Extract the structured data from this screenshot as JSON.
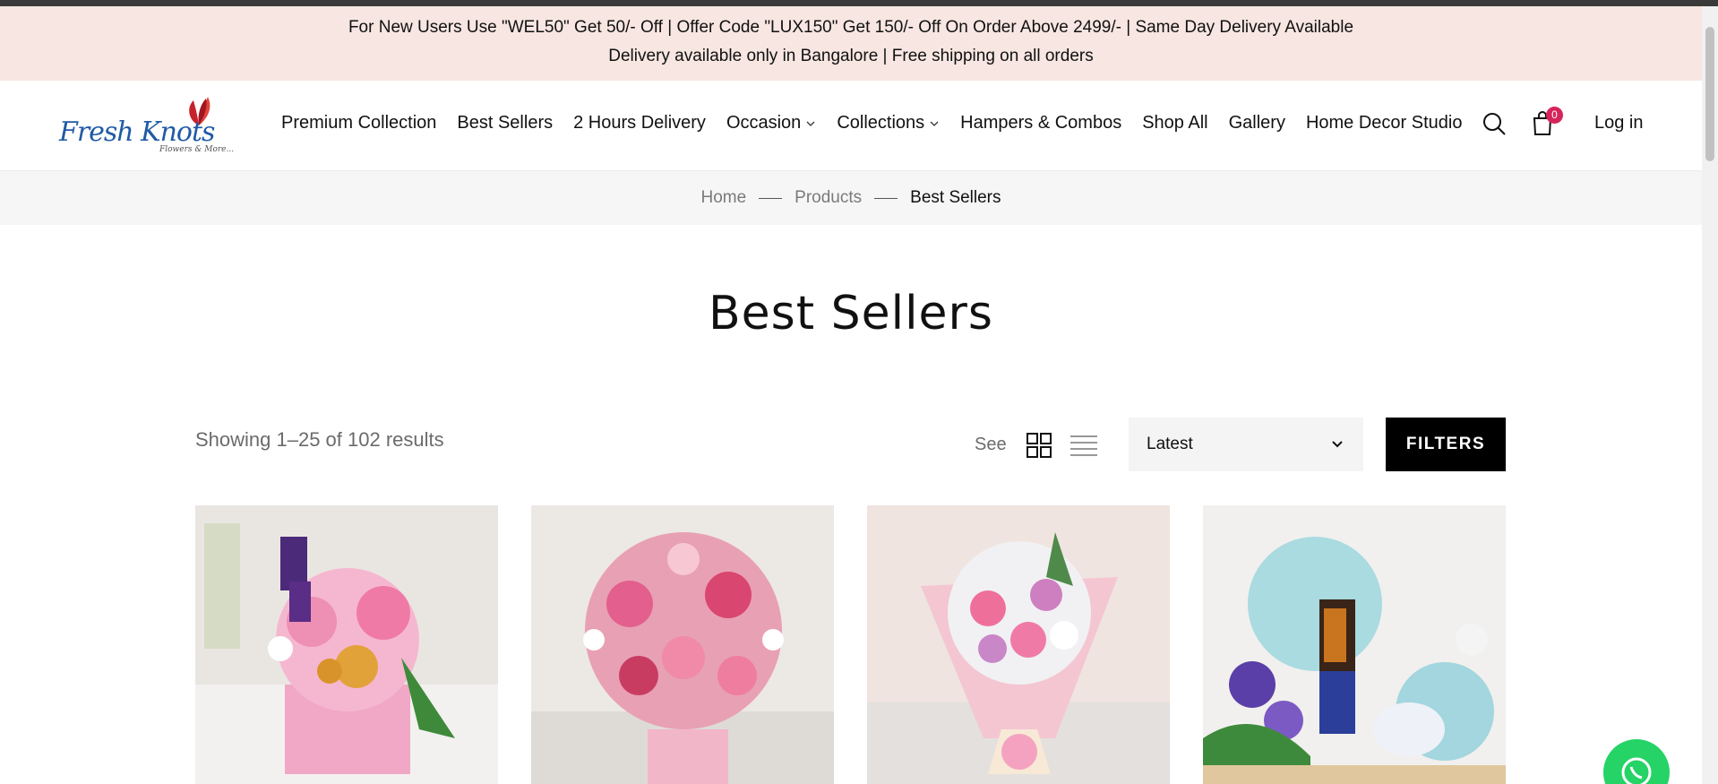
{
  "announcement": {
    "line1": "For New Users Use \"WEL50\" Get 50/- Off | Offer Code \"LUX150\" Get 150/- Off On Order Above 2499/- | Same Day Delivery Available",
    "line2": "Delivery available only in Bangalore | Free shipping on all orders"
  },
  "brand": {
    "name": "Fresh Knots",
    "tagline": "Flowers & More..."
  },
  "nav": {
    "items": [
      {
        "label": "Premium Collection",
        "dropdown": false
      },
      {
        "label": "Best Sellers",
        "dropdown": false
      },
      {
        "label": "2 Hours Delivery",
        "dropdown": false
      },
      {
        "label": "Occasion",
        "dropdown": true
      },
      {
        "label": "Collections",
        "dropdown": true
      },
      {
        "label": "Hampers & Combos",
        "dropdown": false
      },
      {
        "label": "Shop All",
        "dropdown": false
      },
      {
        "label": "Gallery",
        "dropdown": false
      },
      {
        "label": "Home Decor Studio",
        "dropdown": false
      }
    ]
  },
  "header": {
    "cart_count": "0",
    "login_label": "Log in"
  },
  "breadcrumb": {
    "home": "Home",
    "products": "Products",
    "current": "Best Sellers"
  },
  "page": {
    "title": "Best Sellers"
  },
  "toolbar": {
    "results_text": "Showing 1–25 of 102 results",
    "see_label": "See",
    "sort_value": "Latest",
    "filters_label": "FILTERS"
  },
  "products": [
    {
      "image": "pink flower basket with chocolates"
    },
    {
      "image": "pink lilies and roses arrangement"
    },
    {
      "image": "pink roses and daisies bouquet"
    },
    {
      "image": "blue hamper with chocolates and cookies"
    }
  ],
  "colors": {
    "announcement_bg": "#f7e6e1",
    "accent": "#d6245b",
    "button_bg": "#000000",
    "whatsapp": "#25d366"
  }
}
